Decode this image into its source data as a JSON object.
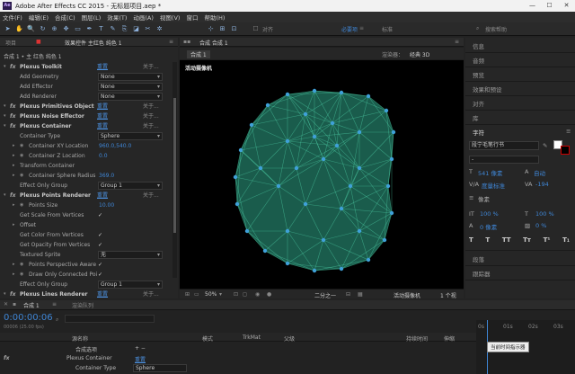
{
  "app": {
    "title": "Adobe After Effects CC 2015 - 无标题项目.aep *",
    "logo": "Ae"
  },
  "window_controls": {
    "min": "—",
    "max": "☐",
    "close": "✕"
  },
  "menu": [
    "文件(F)",
    "编辑(E)",
    "合成(C)",
    "图层(L)",
    "效果(T)",
    "动画(A)",
    "视图(V)",
    "窗口",
    "帮助(H)"
  ],
  "toolbar": {
    "snap_label": "对齐",
    "workspace_default": "必要项",
    "workspace_std": "标准",
    "search_placeholder": "搜索帮助"
  },
  "left_panel": {
    "tab_project": "项目",
    "tab_effects": "效果控件 主红色 纯色 1",
    "subtitle": "合成 1 • 主 红色 纯色 1",
    "rows": [
      {
        "type": "fx",
        "label": "Plexus Toolkit",
        "reset": "重置",
        "about": "关于..."
      },
      {
        "type": "sel",
        "label": "Add Geometry",
        "value": "None"
      },
      {
        "type": "sel",
        "label": "Add Effector",
        "value": "None"
      },
      {
        "type": "sel",
        "label": "Add Renderer",
        "value": "None"
      },
      {
        "type": "fx",
        "label": "Plexus Primitives Object",
        "reset": "重置",
        "about": "关于..."
      },
      {
        "type": "fx",
        "label": "Plexus Noise Effector",
        "reset": "重置",
        "about": "关于..."
      },
      {
        "type": "fx",
        "label": "Plexus Container",
        "reset": "重置",
        "about": "关于..."
      },
      {
        "type": "sel",
        "label": "Container Type",
        "value": "Sphere"
      },
      {
        "type": "val",
        "label": "Container XY Location",
        "value": "960.0,540.0"
      },
      {
        "type": "val",
        "label": "Container Z Location",
        "value": "0.0"
      },
      {
        "type": "plain",
        "label": "Transform Container"
      },
      {
        "type": "val",
        "label": "Container Sphere Radius",
        "value": "369.0"
      },
      {
        "type": "sel",
        "label": "Effect Only Group",
        "value": "Group 1"
      },
      {
        "type": "fx",
        "label": "Plexus Points Renderer",
        "reset": "重置",
        "about": "关于..."
      },
      {
        "type": "val",
        "label": "Points Size",
        "value": "10.00"
      },
      {
        "type": "chk",
        "label": "Get Scale From Vertices",
        "value": "✓"
      },
      {
        "type": "plain",
        "label": "Offset"
      },
      {
        "type": "chk",
        "label": "Get Color From Vertices",
        "value": "✓"
      },
      {
        "type": "chk",
        "label": "Get Opacity From Vertices",
        "value": "✓"
      },
      {
        "type": "sel",
        "label": "Textured Sprite",
        "value": "无"
      },
      {
        "type": "chk",
        "label": "Points Perspective Aware",
        "value": "✓"
      },
      {
        "type": "chk",
        "label": "Draw Only Connected Poi",
        "value": "✓"
      },
      {
        "type": "sel",
        "label": "Effect Only Group",
        "value": "Group 1"
      },
      {
        "type": "fx",
        "label": "Plexus Lines Renderer",
        "reset": "重置",
        "about": "关于..."
      }
    ]
  },
  "viewer": {
    "tab": "合成 合成 1",
    "subtab": "合成 1",
    "renderer_label": "渲染器：",
    "renderer_value": "经典 3D",
    "camera_label": "活动摄像机",
    "zoom": "50%",
    "resolution": "二分之一",
    "camera_dropdown": "活动摄像机",
    "views": "1 个视"
  },
  "right_panel": {
    "items_top": [
      "信息",
      "音频",
      "预览",
      "效果和预设",
      "对齐",
      "库"
    ],
    "char_title": "字符",
    "font_name": "段宁毛笔行书",
    "font_size": "541 像素",
    "leading": "自动",
    "kerning": "度量标准",
    "tracking": "-194",
    "stroke": "像素",
    "vscale": "100 %",
    "hscale": "100 %",
    "baseline": "0 像素",
    "tsume": "0 %",
    "text_styles": [
      "T",
      "T",
      "TT",
      "Tт",
      "T¹",
      "T₁"
    ],
    "items_bottom": [
      "段落",
      "跟踪器"
    ]
  },
  "timeline": {
    "tab_comp": "合成 1",
    "tab_render": "渲染队列",
    "timecode": "0:00:00:06",
    "fps": "00006 (25.00 fps)",
    "col_source": "源名称",
    "col_mode": "模式",
    "col_trkmat": "TrkMat",
    "col_parent": "父级",
    "col_inout": "持续时间",
    "col_stretch": "伸缩",
    "layer1": "合成选项",
    "layer2": "Plexus Container",
    "layer2_reset": "重置",
    "layer3": "Container Type",
    "layer3_value": "Sphere",
    "ruler": [
      "0s",
      "01s",
      "02s",
      "03s"
    ],
    "tooltip": "当前时间指示器"
  }
}
